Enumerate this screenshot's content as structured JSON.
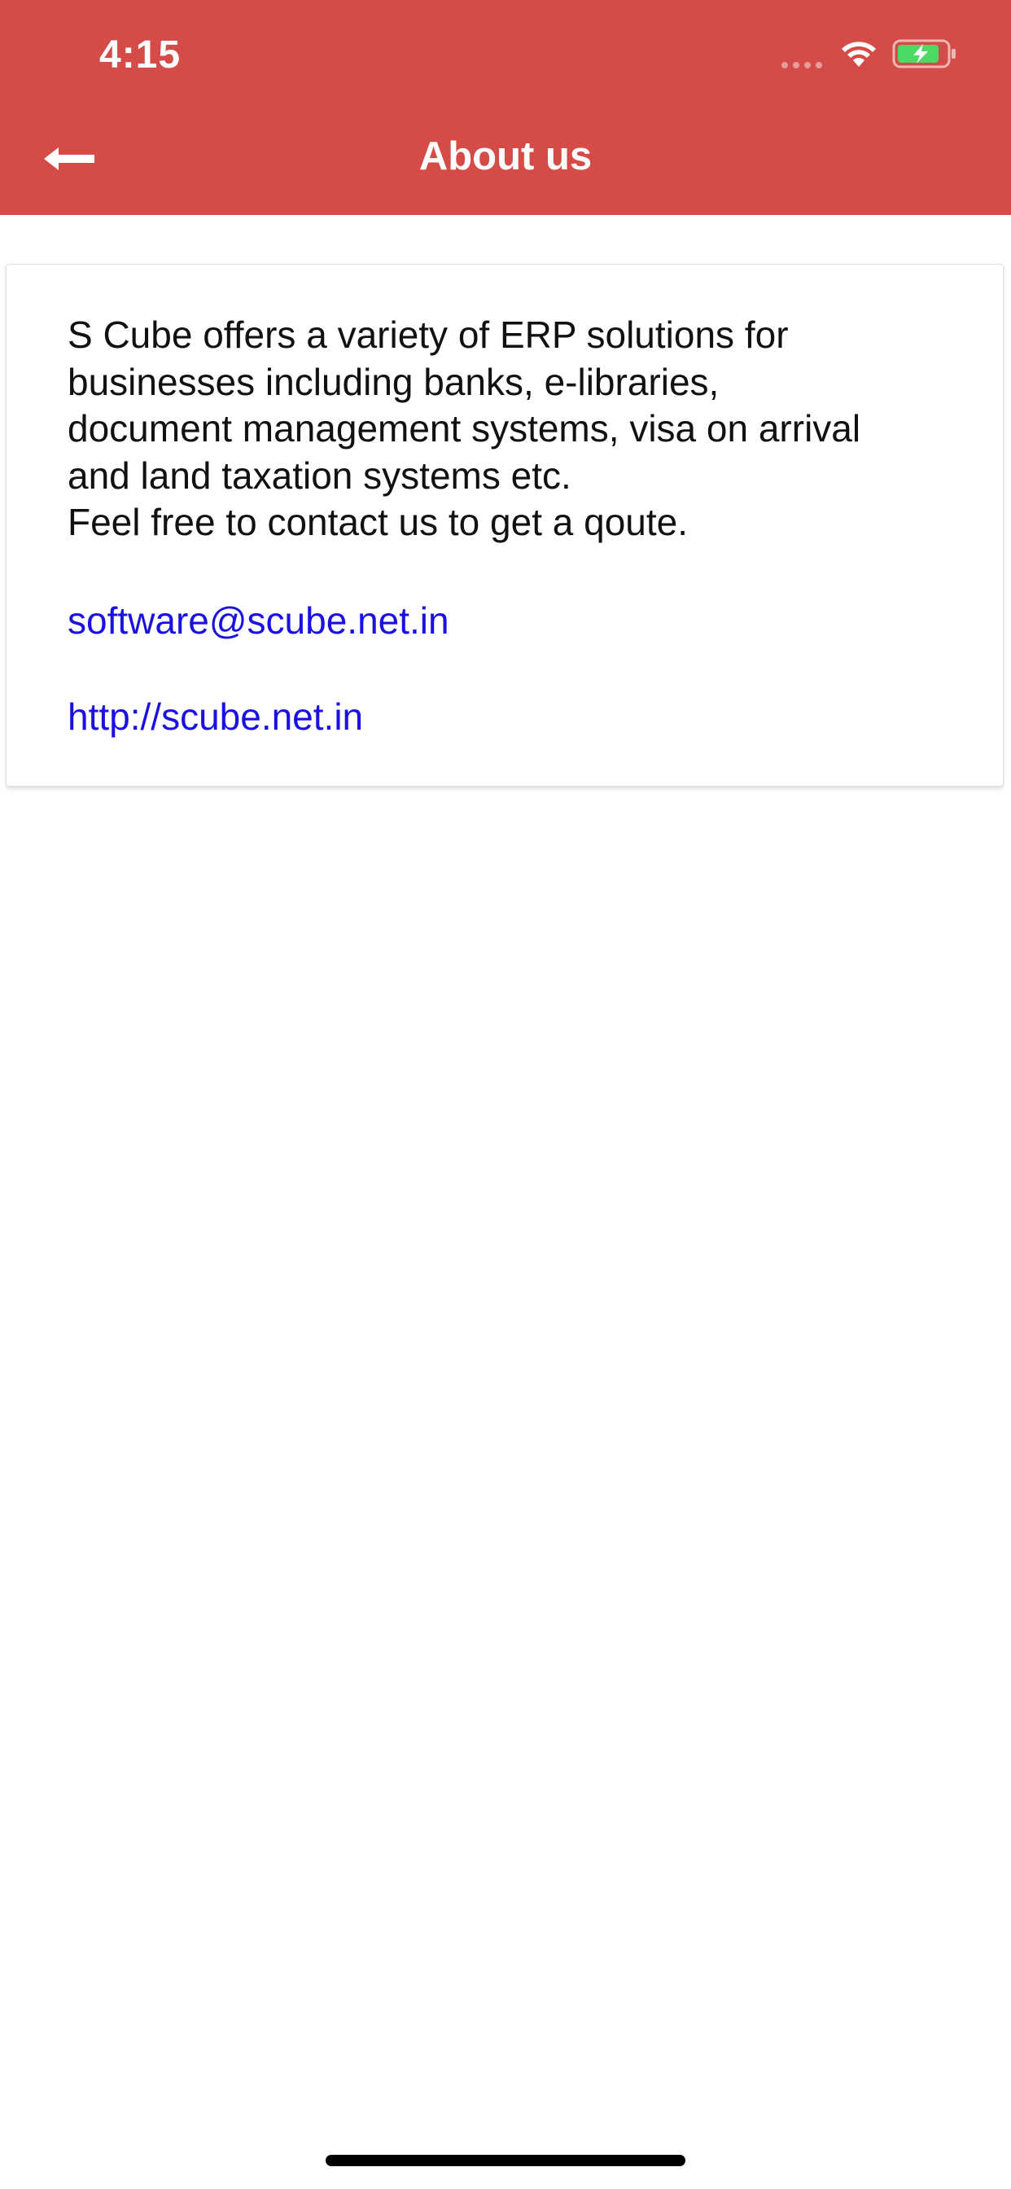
{
  "status_bar": {
    "time": "4:15",
    "icons": [
      "cellular-signal-icon",
      "wifi-icon",
      "battery-charging-icon"
    ]
  },
  "header": {
    "title": "About us",
    "back_icon": "arrow-left-icon"
  },
  "about": {
    "paragraph_lines": [
      "S Cube offers a variety of ERP solutions for",
      "businesses including banks, e-libraries,",
      "document management systems, visa on arrival",
      "and land taxation systems etc.",
      "Feel free to contact us to get a qoute."
    ],
    "email": "software@scube.net.in",
    "website": "http://scube.net.in"
  },
  "colors": {
    "header_bg": "#d44b47",
    "link": "#1a10e0",
    "battery_fill": "#4cd964"
  }
}
